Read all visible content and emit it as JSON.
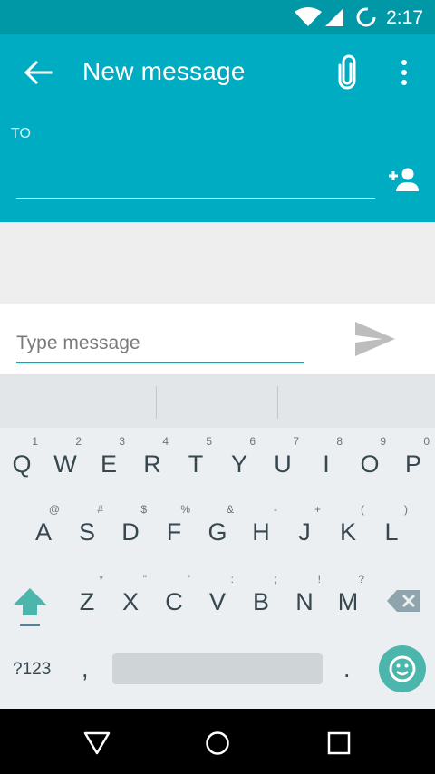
{
  "status_bar": {
    "time": "2:17"
  },
  "app_bar": {
    "title": "New message",
    "to_label": "TO",
    "to_value": ""
  },
  "compose": {
    "placeholder": "Type message",
    "value": ""
  },
  "keyboard": {
    "row1": [
      {
        "key": "Q",
        "hint": "1"
      },
      {
        "key": "W",
        "hint": "2"
      },
      {
        "key": "E",
        "hint": "3"
      },
      {
        "key": "R",
        "hint": "4"
      },
      {
        "key": "T",
        "hint": "5"
      },
      {
        "key": "Y",
        "hint": "6"
      },
      {
        "key": "U",
        "hint": "7"
      },
      {
        "key": "I",
        "hint": "8"
      },
      {
        "key": "O",
        "hint": "9"
      },
      {
        "key": "P",
        "hint": "0"
      }
    ],
    "row2": [
      {
        "key": "A",
        "hint": "@"
      },
      {
        "key": "S",
        "hint": "#"
      },
      {
        "key": "D",
        "hint": "$"
      },
      {
        "key": "F",
        "hint": "%"
      },
      {
        "key": "G",
        "hint": "&"
      },
      {
        "key": "H",
        "hint": "-"
      },
      {
        "key": "J",
        "hint": "+"
      },
      {
        "key": "K",
        "hint": "("
      },
      {
        "key": "L",
        "hint": ")"
      }
    ],
    "row3": [
      {
        "key": "Z",
        "hint": "*"
      },
      {
        "key": "X",
        "hint": "\""
      },
      {
        "key": "C",
        "hint": "'"
      },
      {
        "key": "V",
        "hint": ":"
      },
      {
        "key": "B",
        "hint": ";"
      },
      {
        "key": "N",
        "hint": "!"
      },
      {
        "key": "M",
        "hint": "?"
      }
    ],
    "symbols_label": "?123",
    "comma": ",",
    "period": "."
  },
  "colors": {
    "status_bar": "#0097a7",
    "app_bar": "#00acc1",
    "accent": "#00acc1",
    "emoji_button": "#4db6ac",
    "shift_icon": "#4db6ac"
  },
  "icons": [
    "wifi-icon",
    "cell-signal-icon",
    "sync-icon",
    "back-arrow-icon",
    "attach-icon",
    "more-vert-icon",
    "add-contact-icon",
    "send-icon",
    "shift-icon",
    "backspace-icon",
    "emoji-icon",
    "nav-back-icon",
    "nav-home-icon",
    "nav-recents-icon"
  ]
}
